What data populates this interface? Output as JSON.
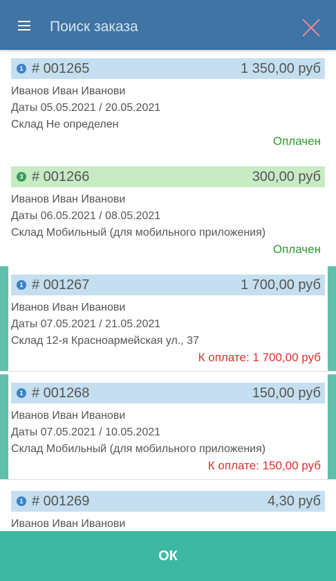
{
  "header": {
    "title": "Поиск заказа",
    "bg_color": "#3f74a4"
  },
  "orders": [
    {
      "badge": "1",
      "badge_color": "blue",
      "number": "# 001265",
      "sum": "1 350,00 руб",
      "customer": "Иванов Иван Иванови",
      "dates": "Даты 05.05.2021 / 20.05.2021",
      "warehouse": "Склад Не определен",
      "status": "Оплачен",
      "status_type": "paid",
      "selected": false
    },
    {
      "badge": "3",
      "badge_color": "green",
      "number": "# 001266",
      "sum": "300,00 руб",
      "customer": "Иванов Иван Иванови",
      "dates": "Даты 06.05.2021 / 08.05.2021",
      "warehouse": "Склад Мобильный (для мобильного приложения)",
      "status": "Оплачен",
      "status_type": "paid",
      "selected": false
    },
    {
      "badge": "1",
      "badge_color": "blue",
      "number": "# 001267",
      "sum": "1 700,00 руб",
      "customer": "Иванов Иван Иванови",
      "dates": "Даты 07.05.2021 / 21.05.2021",
      "warehouse": "Склад 12-я Красноармейская ул., 37",
      "status": "К оплате: 1 700,00 руб",
      "status_type": "due",
      "selected": true
    },
    {
      "badge": "1",
      "badge_color": "blue",
      "number": "# 001268",
      "sum": "150,00 руб",
      "customer": "Иванов Иван Иванови",
      "dates": "Даты 07.05.2021 / 10.05.2021",
      "warehouse": "Склад Мобильный (для мобильного приложения)",
      "status": "К оплате: 150,00 руб",
      "status_type": "due",
      "selected": true
    },
    {
      "badge": "1",
      "badge_color": "blue",
      "number": "# 001269",
      "sum": "4,30 руб",
      "customer": "Иванов Иван Иванови",
      "dates": "",
      "warehouse": "",
      "status": "",
      "status_type": "",
      "selected": false
    }
  ],
  "footer": {
    "ok_label": "ОК",
    "bg_color": "#3cb8a3"
  }
}
